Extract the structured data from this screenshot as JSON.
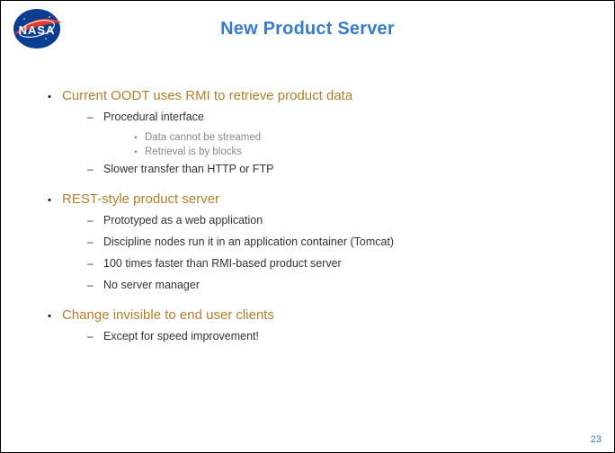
{
  "title": "New Product Server",
  "bullets": [
    {
      "text": "Current OODT uses RMI to retrieve product data",
      "sub": [
        {
          "text": "Procedural interface",
          "sub": [
            {
              "text": "Data cannot be streamed"
            },
            {
              "text": "Retrieval is by blocks"
            }
          ]
        },
        {
          "text": "Slower transfer than HTTP or FTP"
        }
      ]
    },
    {
      "text": "REST-style product server",
      "sub": [
        {
          "text": "Prototyped as a web application"
        },
        {
          "text": "Discipline nodes run it in an application container (Tomcat)"
        },
        {
          "text": "100 times faster than RMI-based product server"
        },
        {
          "text": "No server manager"
        }
      ]
    },
    {
      "text": "Change invisible to end user clients",
      "sub": [
        {
          "text": "Except for speed improvement!"
        }
      ]
    }
  ],
  "page_number": "23",
  "logo_alt": "NASA"
}
